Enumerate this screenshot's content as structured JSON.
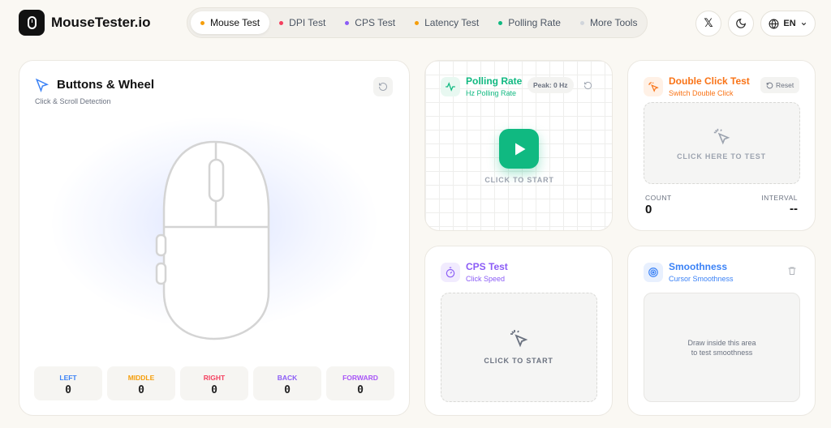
{
  "header": {
    "brand": "MouseTester.io",
    "nav": [
      {
        "label": "Mouse Test",
        "color": "#f59e0b",
        "active": true
      },
      {
        "label": "DPI Test",
        "color": "#f43f5e"
      },
      {
        "label": "CPS Test",
        "color": "#8b5cf6"
      },
      {
        "label": "Latency Test",
        "color": "#f59e0b"
      },
      {
        "label": "Polling Rate",
        "color": "#10b981"
      },
      {
        "label": "More Tools",
        "color": "#d1d5db"
      }
    ],
    "language": "EN",
    "x_glyph": "𝕏"
  },
  "buttons_card": {
    "title": "Buttons & Wheel",
    "subtitle": "Click & Scroll Detection",
    "buttons": [
      {
        "label": "LEFT",
        "value": "0",
        "color": "#3b82f6"
      },
      {
        "label": "MIDDLE",
        "value": "0",
        "color": "#f59e0b"
      },
      {
        "label": "RIGHT",
        "value": "0",
        "color": "#f43f5e"
      },
      {
        "label": "BACK",
        "value": "0",
        "color": "#8b5cf6"
      },
      {
        "label": "FORWARD",
        "value": "0",
        "color": "#a855f7"
      }
    ]
  },
  "polling_card": {
    "title": "Polling Rate",
    "subtitle": "Hz Polling Rate",
    "peak": "Peak: 0 Hz",
    "start_label": "CLICK TO START",
    "accent": "#10b981"
  },
  "double_click_card": {
    "title": "Double Click Test",
    "subtitle": "Switch Double Click",
    "reset_label": "Reset",
    "test_label": "CLICK HERE TO TEST",
    "count_label": "COUNT",
    "count_value": "0",
    "interval_label": "INTERVAL",
    "interval_value": "--",
    "accent": "#f97316"
  },
  "cps_card": {
    "title": "CPS Test",
    "subtitle": "Click Speed",
    "start_label": "CLICK TO START",
    "accent": "#8b5cf6"
  },
  "smoothness_card": {
    "title": "Smoothness",
    "subtitle": "Cursor Smoothness",
    "hint_line1": "Draw inside this area",
    "hint_line2": "to test smoothness",
    "accent": "#3b82f6"
  }
}
